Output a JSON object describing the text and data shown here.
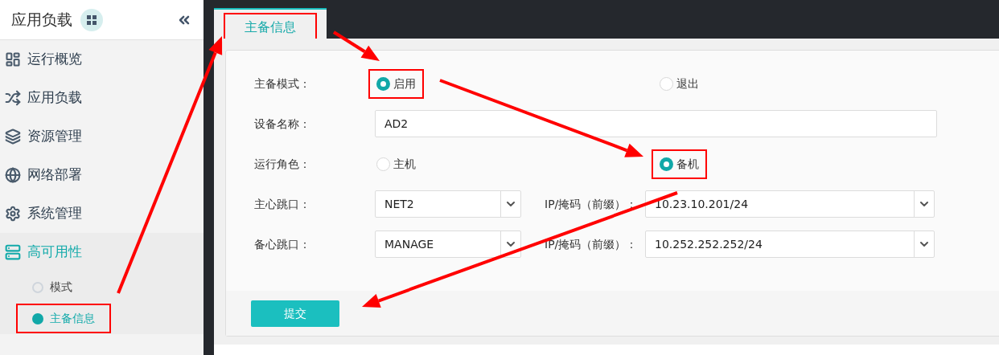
{
  "sidebar": {
    "title": "应用负载",
    "items": [
      {
        "label": "运行概览",
        "expanded": false
      },
      {
        "label": "应用负载",
        "expanded": false
      },
      {
        "label": "资源管理",
        "expanded": false
      },
      {
        "label": "网络部署",
        "expanded": false
      },
      {
        "label": "系统管理",
        "expanded": false
      },
      {
        "label": "高可用性",
        "expanded": true,
        "children": [
          {
            "label": "模式",
            "selected": false,
            "highlighted": false
          },
          {
            "label": "主备信息",
            "selected": true,
            "highlighted": true
          }
        ]
      }
    ]
  },
  "tabs": [
    {
      "label": "主备信息",
      "selected": true,
      "highlighted": true
    }
  ],
  "form": {
    "rows": [
      {
        "kind": "radio",
        "label": "主备模式：",
        "options": [
          {
            "label": "启用",
            "selected": true,
            "highlighted": true
          },
          {
            "label": "退出",
            "selected": false,
            "highlighted": false
          }
        ]
      },
      {
        "kind": "text",
        "label": "设备名称：",
        "value": "AD2"
      },
      {
        "kind": "radio",
        "label": "运行角色：",
        "options": [
          {
            "label": "主机",
            "selected": false,
            "highlighted": false
          },
          {
            "label": "备机",
            "selected": true,
            "highlighted": true
          }
        ]
      },
      {
        "kind": "select_pair",
        "label": "主心跳口：",
        "value": "NET2",
        "ip_label": "IP/掩码（前缀）：",
        "ip_value": "10.23.10.201/24"
      },
      {
        "kind": "select_pair",
        "label": "备心跳口：",
        "value": "MANAGE",
        "ip_label": "IP/掩码（前缀）：",
        "ip_value": "10.252.252.252/24"
      }
    ],
    "submit": "提交"
  }
}
